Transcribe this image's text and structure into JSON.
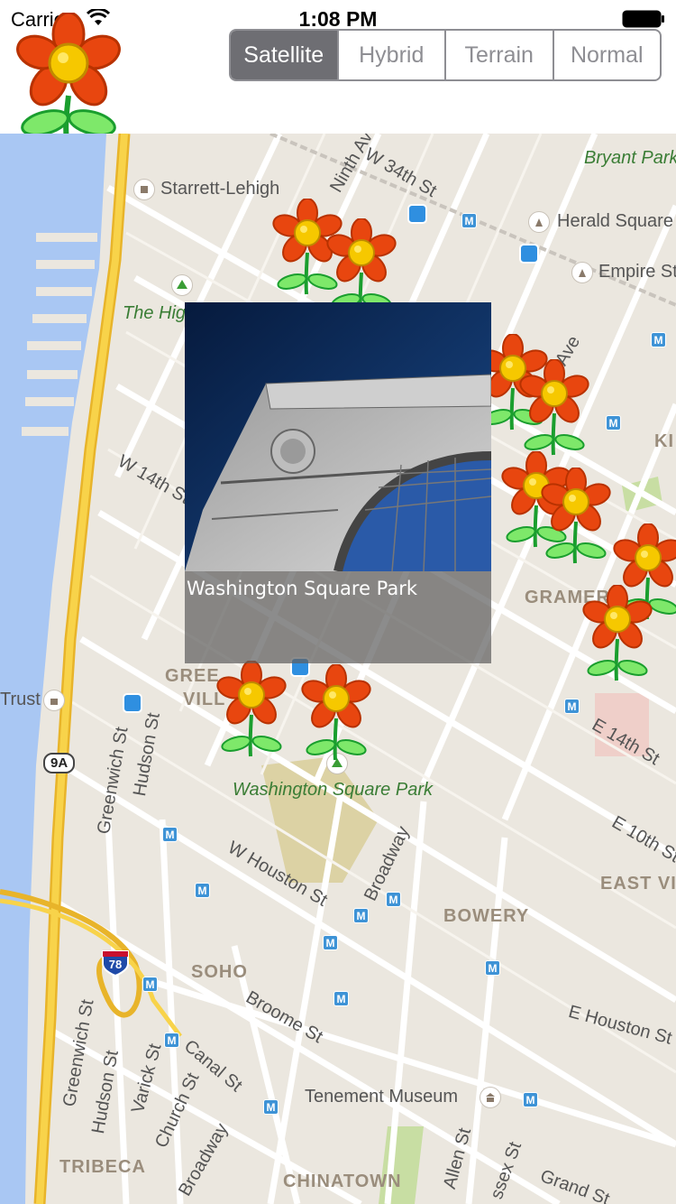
{
  "status_bar": {
    "carrier": "Carrier",
    "time": "1:08 PM"
  },
  "map_type_control": {
    "segments": [
      "Satellite",
      "Hybrid",
      "Terrain",
      "Normal"
    ],
    "selected": "Satellite"
  },
  "map_labels": {
    "starrett": "Starrett-Lehigh",
    "ninth_ave": "Ninth Ave",
    "w34": "W 34th St",
    "bryant": "Bryant Park",
    "herald": "Herald Square",
    "empire": "Empire St",
    "highline": "The High",
    "w14": "W 14th St",
    "kips": "KI",
    "third_ave": "Ave",
    "gramercy": "GRAMER",
    "greenwich_village_1": "GREE",
    "greenwich_village_2": "VILL",
    "trust": "Trust",
    "route_9a": "9A",
    "greenwich_st_1": "Greenwich St",
    "hudson_st_1": "Hudson St",
    "wsp_map": "Washington Square Park",
    "e14": "E 14th St",
    "e10": "E 10th St",
    "east_vil": "EAST VI",
    "w_houston": "W Houston St",
    "broadway_1": "Broadway",
    "bowery": "BOWERY",
    "interstate_78": "78",
    "soho": "SOHO",
    "broome": "Broome St",
    "e_houston": "E Houston St",
    "canal": "Canal St",
    "greenwich_st_2": "Greenwich St",
    "hudson_st_2": "Hudson St",
    "varick": "Varick St",
    "church": "Church St",
    "broadway_2": "Broadway",
    "tenement": "Tenement Museum",
    "allen": "Allen St",
    "essex": "ssex St",
    "grand": "Grand St",
    "tribeca": "TRIBECA",
    "chinatown": "CHINATOWN",
    "metro_glyph": "M"
  },
  "callout": {
    "title": "Washington Square Park"
  },
  "colors": {
    "water": "#a9c7f3",
    "highway": "#f4c430",
    "park": "#c8dea3",
    "selected_segment": "#6e6e73"
  }
}
